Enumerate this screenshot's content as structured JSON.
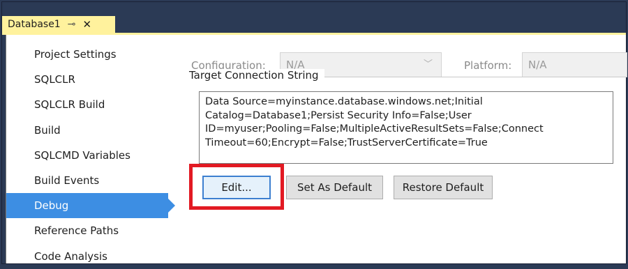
{
  "tab": {
    "title": "Database1",
    "pin_icon": "pin-icon",
    "close_icon": "close-icon"
  },
  "sidebar": {
    "items": [
      {
        "label": "Project Settings",
        "selected": false
      },
      {
        "label": "SQLCLR",
        "selected": false
      },
      {
        "label": "SQLCLR Build",
        "selected": false
      },
      {
        "label": "Build",
        "selected": false
      },
      {
        "label": "SQLCMD Variables",
        "selected": false
      },
      {
        "label": "Build Events",
        "selected": false
      },
      {
        "label": "Debug",
        "selected": true
      },
      {
        "label": "Reference Paths",
        "selected": false
      },
      {
        "label": "Code Analysis",
        "selected": false
      }
    ]
  },
  "config": {
    "configuration_label": "Configuration:",
    "configuration_value": "N/A",
    "platform_label": "Platform:",
    "platform_value": "N/A"
  },
  "connection": {
    "group_title": "Target Connection String",
    "value": "Data Source=myinstance.database.windows.net;Initial Catalog=Database1;Persist Security Info=False;User ID=myuser;Pooling=False;MultipleActiveResultSets=False;Connect Timeout=60;Encrypt=False;TrustServerCertificate=True",
    "lines": [
      "Data Source=myinstance.database.windows.net;Initial",
      "Catalog=Database1;Persist Security Info=False;User",
      "ID=myuser;Pooling=False;MultipleActiveResultSets=False;Connect",
      "Timeout=60;Encrypt=False;TrustServerCertificate=True"
    ]
  },
  "buttons": {
    "edit": "Edit...",
    "set_default": "Set As Default",
    "restore_default": "Restore Default"
  },
  "colors": {
    "tab_active": "#fff29d",
    "selected_nav": "#3d8ee3",
    "highlight": "#e21a23",
    "chrome": "#2b3a55"
  }
}
